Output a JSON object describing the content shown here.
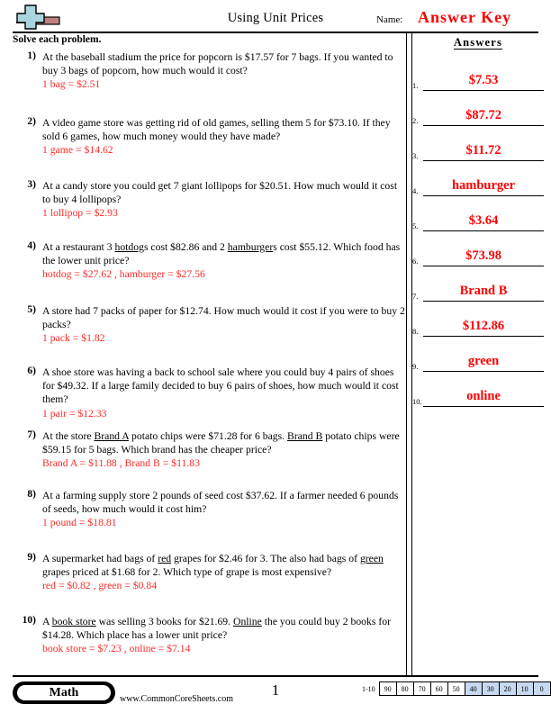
{
  "header": {
    "title": "Using Unit Prices",
    "name_label": "Name:",
    "answer_key": "Answer Key",
    "logo_icon": "plus-block-logo",
    "logo_colors": {
      "plus": "#aad5dc",
      "block": "#c08080",
      "outline": "#000000"
    }
  },
  "instruction": "Solve each problem.",
  "answers_heading": "Answers",
  "problems": [
    {
      "number": "1)",
      "question": "At the baseball stadium the price for popcorn is $17.57 for 7 bags. If you wanted to buy 3 bags of popcorn, how much would it cost?",
      "work": "1 bag = $2.51"
    },
    {
      "number": "2)",
      "question": "A video game store was getting rid of old games, selling them 5 for $73.10. If they sold 6 games, how much money would they have made?",
      "work": "1 game = $14.62"
    },
    {
      "number": "3)",
      "question": "At a candy store you could get 7 giant lollipops for $20.51. How much would it cost to buy 4 lollipops?",
      "work": "1 lollipop = $2.93"
    },
    {
      "number": "4)",
      "question_html": "At a restaurant 3 <u>hotdog</u>s cost $82.86 and 2 <u>hamburger</u>s cost $55.12. Which food has the lower unit price?",
      "work": "hotdog = $27.62 , hamburger = $27.56"
    },
    {
      "number": "5)",
      "question": "A store had 7 packs of paper for $12.74. How much would it cost if you were to buy 2 packs?",
      "work": "1 pack = $1.82"
    },
    {
      "number": "6)",
      "question": "A shoe store was having a back to school sale where you could buy 4 pairs of shoes for $49.32. If a large family decided to buy 6 pairs of shoes, how much would it cost them?",
      "work": "1 pair = $12.33"
    },
    {
      "number": "7)",
      "question_html": "At the store <u>Brand A</u> potato chips were $71.28 for 6 bags. <u>Brand B</u> potato chips were $59.15 for 5 bags. Which brand has the cheaper price?",
      "work": "Brand A = $11.88 , Brand B = $11.83"
    },
    {
      "number": "8)",
      "question": "At a farming supply store 2 pounds of seed cost $37.62. If a farmer needed 6 pounds of seeds, how much would it cost him?",
      "work": "1 pound = $18.81"
    },
    {
      "number": "9)",
      "question_html": "A supermarket had bags of <u>red</u> grapes for $2.46 for 3. The also had bags of <u>green</u> grapes priced at $1.68 for 2. Which type of grape is most expensive?",
      "work": "red = $0.82 , green = $0.84"
    },
    {
      "number": "10)",
      "question_html": "A <u>book store</u> was selling 3 books for $21.69. <u>Online</u> the you could buy 2 books for $14.28. Which place has a lower unit price?",
      "work": "book store = $7.23 , online = $7.14"
    }
  ],
  "answers": [
    {
      "number": "1.",
      "value": "$7.53"
    },
    {
      "number": "2.",
      "value": "$87.72"
    },
    {
      "number": "3.",
      "value": "$11.72"
    },
    {
      "number": "4.",
      "value": "hamburger"
    },
    {
      "number": "5.",
      "value": "$3.64"
    },
    {
      "number": "6.",
      "value": "$73.98"
    },
    {
      "number": "7.",
      "value": "Brand B"
    },
    {
      "number": "8.",
      "value": "$112.86"
    },
    {
      "number": "9.",
      "value": "green"
    },
    {
      "number": "10.",
      "value": "online"
    }
  ],
  "footer": {
    "subject_badge": "Math",
    "site_url": "www.CommonCoreSheets.com",
    "page_number": "1",
    "score_label": "1-10",
    "score_cells": [
      {
        "value": "90",
        "highlighted": false
      },
      {
        "value": "80",
        "highlighted": false
      },
      {
        "value": "70",
        "highlighted": false
      },
      {
        "value": "60",
        "highlighted": false
      },
      {
        "value": "50",
        "highlighted": false
      },
      {
        "value": "40",
        "highlighted": true
      },
      {
        "value": "30",
        "highlighted": true
      },
      {
        "value": "20",
        "highlighted": true
      },
      {
        "value": "10",
        "highlighted": true
      },
      {
        "value": "0",
        "highlighted": true
      }
    ],
    "highlight_color": "#c5d9f1"
  },
  "colors": {
    "answer_red": "#ff0000",
    "work_red": "#ff2a2a",
    "rule": "#000000"
  }
}
